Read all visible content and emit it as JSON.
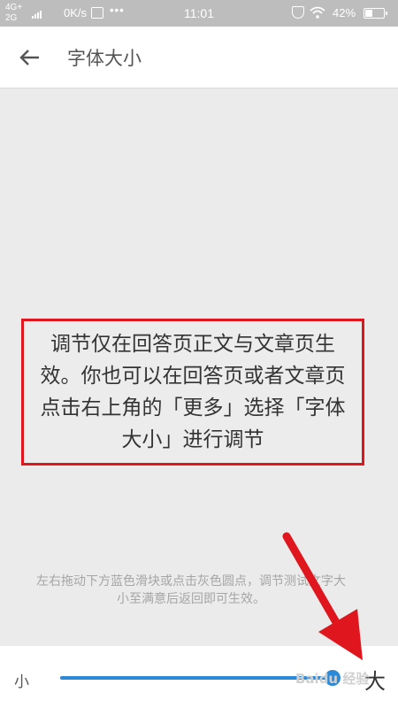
{
  "status_bar": {
    "network_top": "4G+",
    "network_bottom": "2G",
    "speed": "0K/s",
    "more": "•••",
    "time": "11:01",
    "battery_percent": "42%",
    "battery_level": 0.42
  },
  "app_bar": {
    "back_icon": "arrow-left-icon",
    "title": "字体大小"
  },
  "notice": {
    "text": "调节仅在回答页正文与文章页生效。你也可以在回答页或者文章页点击右上角的「更多」选择「字体大小」进行调节"
  },
  "hint": {
    "text": "左右拖动下方蓝色滑块或点击灰色圆点，调节测试文字大小至满意后返回即可生效。"
  },
  "font_slider": {
    "label_small": "小",
    "label_large": "大",
    "value": 1.0,
    "accent_color": "#2b8ad8"
  },
  "annotation": {
    "color": "#e0161e",
    "watermark": "Baidu 经验"
  }
}
